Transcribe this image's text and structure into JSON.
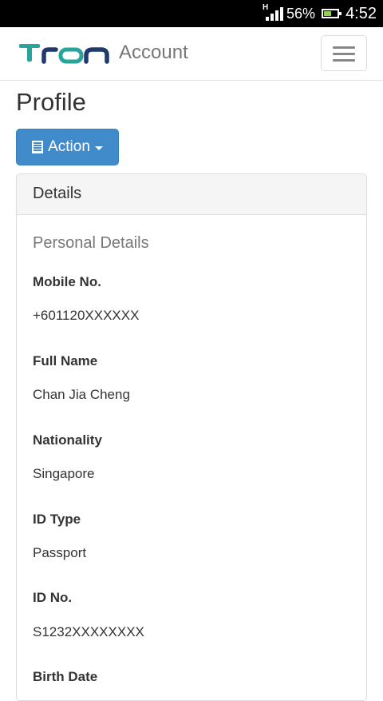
{
  "status_bar": {
    "network_type": "H",
    "battery_percent": "56%",
    "battery_level": 0.56,
    "time": "4:52"
  },
  "navbar": {
    "logo_text": "TRON",
    "brand": "Account",
    "menu_icon": "hamburger-icon"
  },
  "page": {
    "title": "Profile"
  },
  "action_button": {
    "icon": "list-icon",
    "label": "Action"
  },
  "panel": {
    "heading": "Details",
    "section_title": "Personal Details",
    "fields": [
      {
        "label": "Mobile No.",
        "value": "+601120XXXXXX"
      },
      {
        "label": "Full Name",
        "value": "Chan Jia Cheng"
      },
      {
        "label": "Nationality",
        "value": "Singapore"
      },
      {
        "label": "ID Type",
        "value": "Passport"
      },
      {
        "label": "ID No.",
        "value": "S1232XXXXXXXX"
      },
      {
        "label": "Birth Date",
        "value": ""
      }
    ]
  },
  "colors": {
    "primary": "#428bca",
    "logo_teal": "#2aa39a",
    "logo_navy": "#1f3a6b"
  }
}
